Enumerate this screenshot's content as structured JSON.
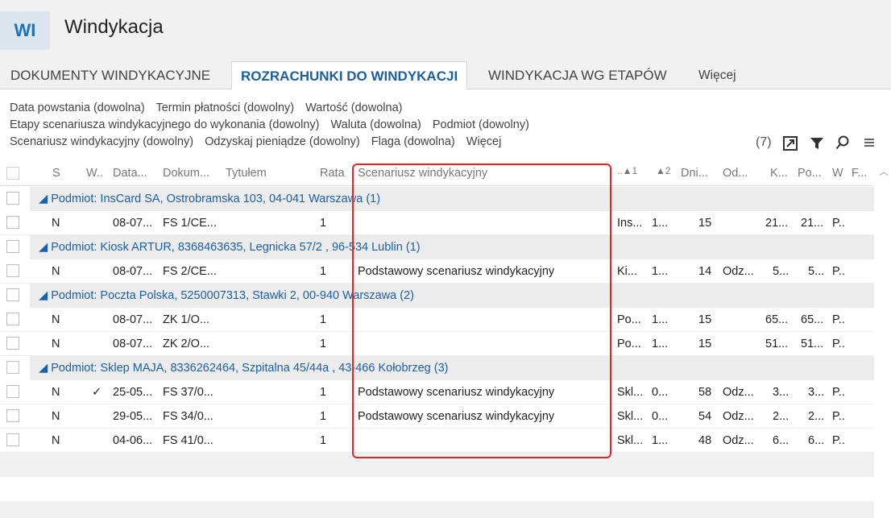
{
  "app": {
    "badge": "WI",
    "title": "Windykacja"
  },
  "tabs": [
    {
      "label": "DOKUMENTY WINDYKACYJNE"
    },
    {
      "label": "ROZRACHUNKI DO WINDYKACJI"
    },
    {
      "label": "WINDYKACJA WG ETAPÓW"
    },
    {
      "label": "Więcej"
    }
  ],
  "filters": {
    "line1": [
      "Data powstania (dowolna)",
      "Termin płatności (dowolny)",
      "Wartość (dowolna)"
    ],
    "line2": [
      "Etapy scenariusza windykacyjnego do wykonania (dowolny)",
      "Waluta (dowolna)",
      "Podmiot (dowolny)"
    ],
    "line3": [
      "Scenariusz windykacyjny (dowolny)",
      "Odzyskaj pieniądze (dowolny)",
      "Flaga (dowolna)",
      "Więcej"
    ]
  },
  "toolbar": {
    "count": "(7)",
    "export_icon": "export-icon",
    "filter_icon": "filter-icon",
    "search_icon": "search-icon",
    "menu_icon": "menu-icon"
  },
  "columns": [
    "S",
    "W...",
    "Data...",
    "Dokum...",
    "Tytułem",
    "Rata",
    "Scenariusz windykacyjny",
    "..▲1",
    "▲2",
    "Dni...",
    "Od...",
    "K...",
    "Po...",
    "W",
    "F..."
  ],
  "groups": [
    {
      "label": "Podmiot: InsCard SA, Ostrobramska 103, 04-041 Warszawa",
      "count": "(1)",
      "rows": [
        {
          "s": "N",
          "w": "",
          "data": "08-07...",
          "dok": "FS 1/CE...",
          "rata": "1",
          "scen": "",
          "p": "Ins...",
          "p2": "1...",
          "dni": "15",
          "od": "",
          "k": "21...",
          "po": "21...",
          "wp": "P.."
        }
      ]
    },
    {
      "label": "Podmiot: Kiosk ARTUR, 8368463635, Legnicka  57/2 , 96-534 Lublin",
      "count": "(1)",
      "rows": [
        {
          "s": "N",
          "w": "",
          "data": "08-07...",
          "dok": "FS 2/CE...",
          "rata": "1",
          "scen": "Podstawowy scenariusz windykacyjny",
          "p": "Ki...",
          "p2": "1...",
          "dni": "14",
          "od": "Odz...",
          "k": "5...",
          "po": "5...",
          "wp": "P.."
        }
      ]
    },
    {
      "label": "Podmiot: Poczta Polska, 5250007313, Stawki 2, 00-940 Warszawa",
      "count": "(2)",
      "rows": [
        {
          "s": "N",
          "w": "",
          "data": "08-07...",
          "dok": "ZK 1/O...",
          "rata": "1",
          "scen": "",
          "p": "Po...",
          "p2": "1...",
          "dni": "15",
          "od": "",
          "k": "65...",
          "po": "65...",
          "wp": "P.."
        },
        {
          "s": "N",
          "w": "",
          "data": "08-07...",
          "dok": "ZK 2/O...",
          "rata": "1",
          "scen": "",
          "p": "Po...",
          "p2": "1...",
          "dni": "15",
          "od": "",
          "k": "51...",
          "po": "51...",
          "wp": "P.."
        }
      ]
    },
    {
      "label": "Podmiot: Sklep MAJA, 8336262464, Szpitalna  45/44a , 43-466 Kołobrzeg",
      "count": "(3)",
      "rows": [
        {
          "s": "N",
          "w": "✓",
          "data": "25-05...",
          "dok": "FS 37/0...",
          "rata": "1",
          "scen": "Podstawowy scenariusz windykacyjny",
          "p": "Skl...",
          "p2": "0...",
          "dni": "58",
          "od": "Odz...",
          "k": "3...",
          "po": "3...",
          "wp": "P.."
        },
        {
          "s": "N",
          "w": "",
          "data": "29-05...",
          "dok": "FS 34/0...",
          "rata": "1",
          "scen": "Podstawowy scenariusz windykacyjny",
          "p": "Skl...",
          "p2": "0...",
          "dni": "54",
          "od": "Odz...",
          "k": "2...",
          "po": "2...",
          "wp": "P.."
        },
        {
          "s": "N",
          "w": "",
          "data": "04-06...",
          "dok": "FS 41/0...",
          "rata": "1",
          "scen": "",
          "p": "Skl...",
          "p2": "1...",
          "dni": "48",
          "od": "Odz...",
          "k": "6...",
          "po": "6...",
          "wp": "P.."
        }
      ]
    }
  ]
}
